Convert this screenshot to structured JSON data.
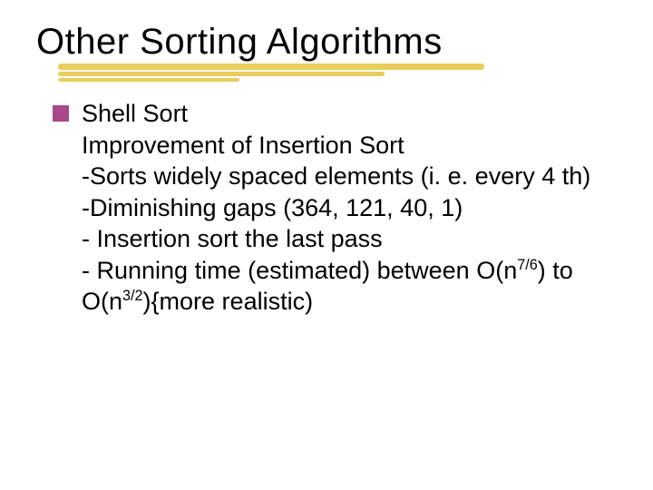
{
  "title": "Other Sorting Algorithms",
  "bullet": {
    "name": "Shell Sort",
    "lines": {
      "l1": "Improvement of Insertion Sort",
      "l2": "-Sorts widely spaced elements (i. e. every 4 th)",
      "l3": "-Diminishing gaps (364, 121, 40, 1)",
      "l4": "- Insertion sort the last pass",
      "running_pre": "- Running time (estimated) between O(n",
      "running_sup1": "7/6",
      "running_mid": ") to O(n",
      "running_sup2": "3/2",
      "running_post": "){more realistic)"
    }
  }
}
